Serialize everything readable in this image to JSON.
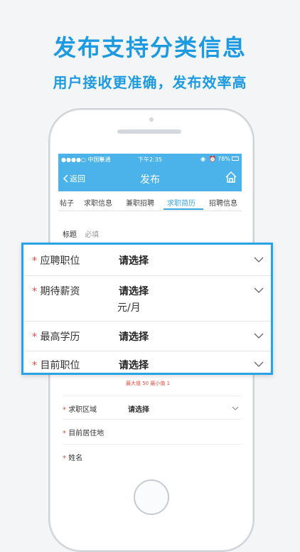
{
  "promo": {
    "headline": "发布支持分类信息",
    "subheadline": "用户接收更准确，发布效率高"
  },
  "status_bar": {
    "carrier": "●●●●○ 中国联通",
    "time": "下午2:35",
    "battery": "78%"
  },
  "nav": {
    "back_label": "返回",
    "title": "发布"
  },
  "tabs": [
    {
      "label": "帖子"
    },
    {
      "label": "求职信息"
    },
    {
      "label": "兼职招聘"
    },
    {
      "label": "求职简历",
      "active": true
    },
    {
      "label": "招聘信息"
    }
  ],
  "form": {
    "title_label": "标题",
    "title_placeholder": "必填",
    "salary_hint": "最大值 50  最小值 1",
    "area_label": "求职区域",
    "area_value": "请选择",
    "residence_label": "目前居住地",
    "name_label": "姓名",
    "required_mark": "*"
  },
  "callout": {
    "rows": [
      {
        "label": "应聘职位",
        "value": "请选择"
      },
      {
        "label": "期待薪资",
        "value": "请选择",
        "unit": "元/月"
      },
      {
        "label": "最高学历",
        "value": "请选择"
      },
      {
        "label": "目前职位",
        "value": "请选择"
      }
    ]
  },
  "colors": {
    "brand_blue": "#1e9be0",
    "nav_blue": "#4bb3ea",
    "required_red": "#e24b3c"
  }
}
